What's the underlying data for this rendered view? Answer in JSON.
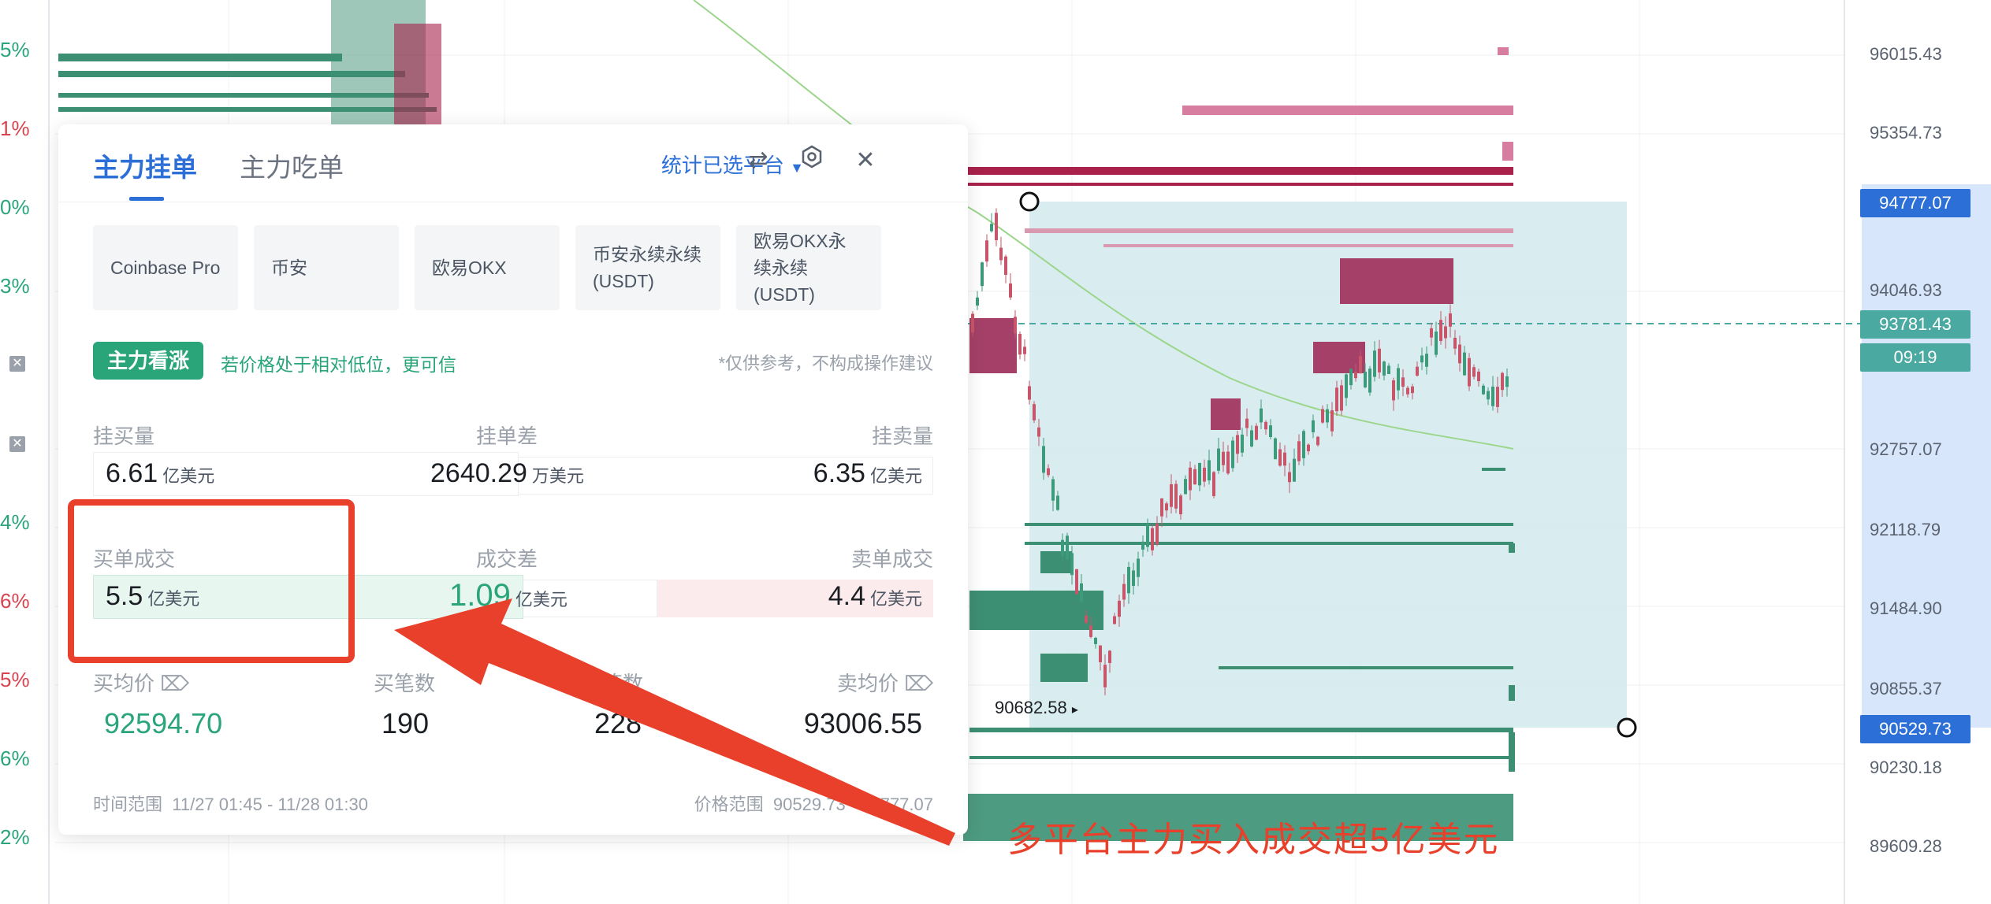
{
  "left_axis": {
    "percent_labels": [
      "5%",
      "1%",
      "0%",
      "3%",
      "4%",
      "6%",
      "5%",
      "6%",
      "2%"
    ],
    "percent_colors": [
      "g",
      "r",
      "g",
      "g",
      "g",
      "r",
      "r",
      "g",
      "g"
    ]
  },
  "right_axis": {
    "price_labels": [
      "96015.43",
      "95354.73",
      "94046.93",
      "92757.07",
      "92118.79",
      "91484.90",
      "90855.37",
      "90230.18",
      "89609.28"
    ],
    "tag_high": "94777.07",
    "tag_current": "93781.43",
    "tag_countdown": "09:19",
    "tag_low": "90529.73",
    "tag_high_color": "#2c6fd6",
    "tag_current_color": "#4aa9a0",
    "tag_low_color": "#2c6fd6"
  },
  "chart": {
    "low_price_label": "90682.58",
    "annotation": "多平台主力买入成交超5亿美元",
    "annotation_color": "#e8402a"
  },
  "panel": {
    "tabs": [
      {
        "label": "主力挂单",
        "active": true
      },
      {
        "label": "主力吃单",
        "active": false
      }
    ],
    "stat_selector": "统计已选平台",
    "icons": [
      "swap-icon",
      "settings-icon",
      "close-icon"
    ],
    "platforms": [
      "Coinbase Pro",
      "币安",
      "欧易OKX",
      "币安永续永续(USDT)",
      "欧易OKX永续永续(USDT)"
    ],
    "signal_badge": "主力看涨",
    "signal_hint": "若价格处于相对低位，更可信",
    "disclaimer": "*仅供参考，不构成操作建议",
    "order_book": {
      "buy_label": "挂买量",
      "diff_label": "挂单差",
      "sell_label": "挂卖量",
      "buy_value": "6.61",
      "buy_unit": "亿美元",
      "diff_value": "2640.29",
      "diff_unit": "万美元",
      "sell_value": "6.35",
      "sell_unit": "亿美元"
    },
    "trades": {
      "buy_label": "买单成交",
      "diff_label": "成交差",
      "sell_label": "卖单成交",
      "buy_value": "5.5",
      "buy_unit": "亿美元",
      "diff_value": "1.09",
      "diff_unit": "亿美元",
      "sell_value": "4.4",
      "sell_unit": "亿美元"
    },
    "averages": {
      "buy_avg_label": "买均价",
      "buy_count_label": "买笔数",
      "sell_count_label": "卖笔数",
      "sell_avg_label": "卖均价",
      "buy_avg_value": "92594.70",
      "buy_count_value": "190",
      "sell_count_value": "228",
      "sell_avg_value": "93006.55"
    },
    "footer": {
      "time_range_label": "时间范围",
      "time_range_value": "11/27 01:45 - 11/28 01:30",
      "price_range_label": "价格范围",
      "price_range_value": "90529.73 - 94777.07"
    }
  }
}
